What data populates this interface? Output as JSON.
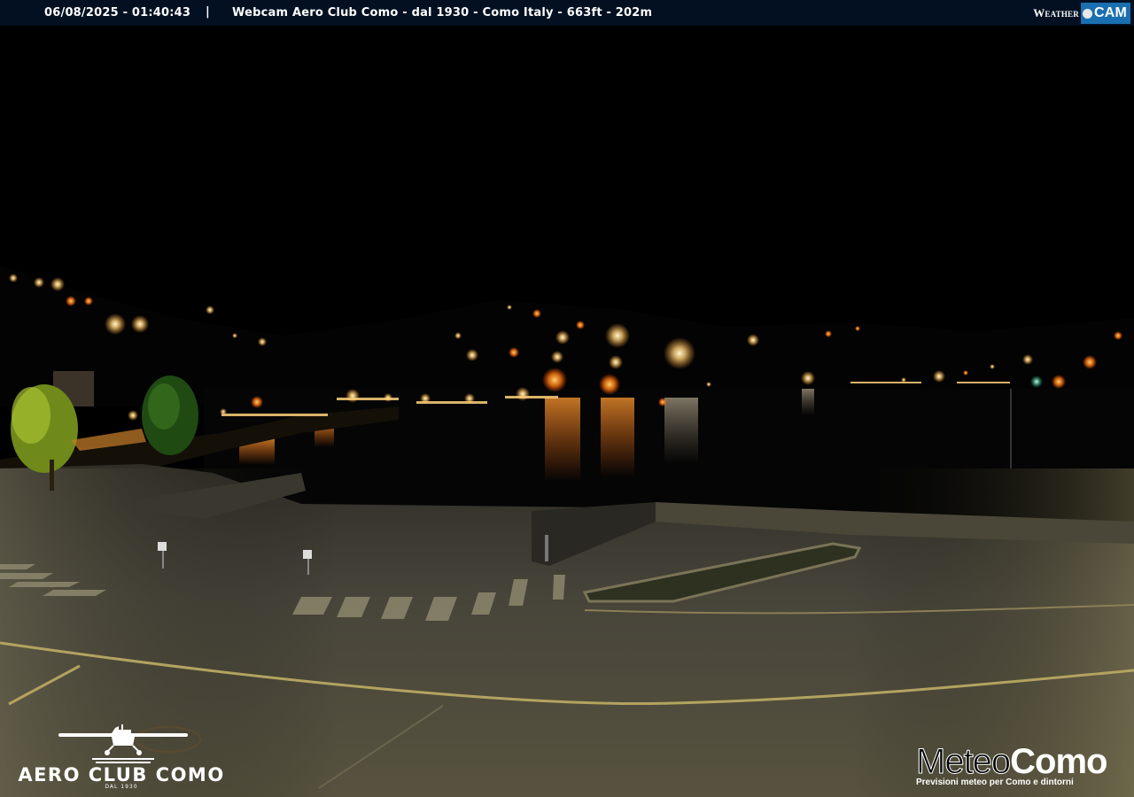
{
  "header": {
    "timestamp": "06/08/2025 - 01:40:43",
    "separator": "|",
    "caption": "Webcam  Aero Club Como - dal 1930 - Como Italy - 663ft - 202m"
  },
  "watermark_top": {
    "word1": "Weather",
    "word2": "CAM"
  },
  "logo_left": {
    "name": "AERO  CLUB  COMO",
    "since": "DAL 1930"
  },
  "logo_right": {
    "title_light": "Meteo",
    "title_bold": "Como",
    "subtitle": "Previsioni meteo per Como e dintorni"
  },
  "colors": {
    "topbar": "#021022",
    "sky": "#000000",
    "lake": "#050505",
    "road": "#4a473c",
    "lights": "#ffd27a"
  }
}
